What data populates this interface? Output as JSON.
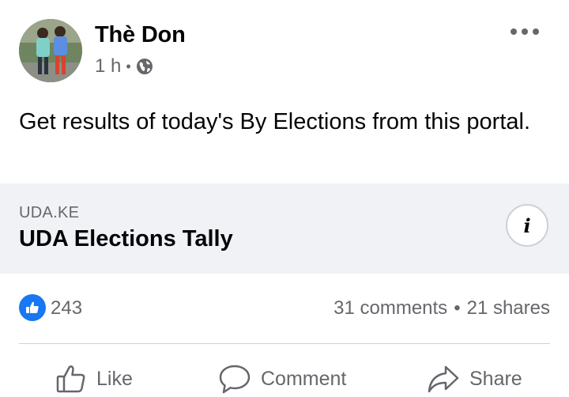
{
  "post": {
    "author": "Thè Don",
    "time": "1 h",
    "separator": "•",
    "text": "Get results of today's By Elections from this portal."
  },
  "link": {
    "domain": "UDA.KE",
    "title": "UDA Elections Tally",
    "info_glyph": "i"
  },
  "stats": {
    "likes": "243",
    "comments": "31 comments",
    "dot": "•",
    "shares": "21 shares"
  },
  "actions": {
    "like": "Like",
    "comment": "Comment",
    "share": "Share"
  },
  "icons": {
    "audience": "globe-icon",
    "more": "more-options-icon",
    "like": "thumbs-up-icon",
    "comment": "speech-bubble-icon",
    "share": "share-arrow-icon"
  },
  "colors": {
    "accent": "#1877f2",
    "secondary_text": "#65676b",
    "card_bg": "#f0f2f5"
  }
}
